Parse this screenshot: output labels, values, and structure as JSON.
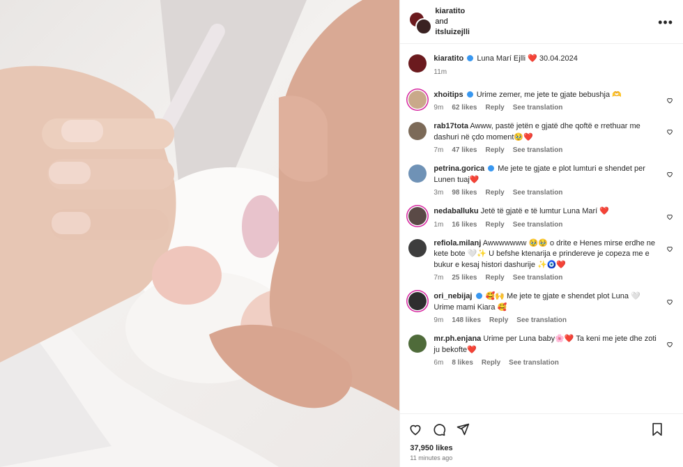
{
  "header": {
    "user1": "kiaratito",
    "joiner": "and",
    "user2": "itsluizejlli",
    "more_icon": "more-horizontal-icon"
  },
  "caption": {
    "user": "kiaratito",
    "text": "Luna Marí Ejlli ❤️ 30.04.2024",
    "time": "11m"
  },
  "comments": [
    {
      "user": "xhoitips",
      "verified": true,
      "text": "Urime zemer, me jete te gjate bebushja 🫶",
      "time": "9m",
      "likes": "62 likes",
      "reply": "Reply",
      "translate": "See translation",
      "avatar_color": "#c9a98a",
      "ring": true
    },
    {
      "user": "rab17tota",
      "verified": false,
      "text": "Awww, pastë jetën e gjatë dhe qoftë e rrethuar me dashuri në çdo moment🥹❤️",
      "time": "7m",
      "likes": "47 likes",
      "reply": "Reply",
      "translate": "See translation",
      "avatar_color": "#7c6a58",
      "ring": false
    },
    {
      "user": "petrina.gorica",
      "verified": true,
      "text": "Me jete te gjate e plot lumturi e shendet per Lunen tuaj❤️",
      "time": "3m",
      "likes": "98 likes",
      "reply": "Reply",
      "translate": "See translation",
      "avatar_color": "#6f92b6",
      "ring": false
    },
    {
      "user": "nedaballuku",
      "verified": false,
      "text": "Jetë të gjatë e të lumtur Luna Marí ❤️",
      "time": "1m",
      "likes": "16 likes",
      "reply": "Reply",
      "translate": "See translation",
      "avatar_color": "#5a4a46",
      "ring": true
    },
    {
      "user": "refiola.milanj",
      "verified": false,
      "text": "Awwwwwww 🥹🥹 o drite e Henes mirse erdhe ne kete bote 🤍✨ U befshe ktenarija e prindereve je copeza me e bukur e kesaj histori dashurije ✨🧿❤️",
      "time": "7m",
      "likes": "25 likes",
      "reply": "Reply",
      "translate": "See translation",
      "avatar_color": "#3d3d3d",
      "ring": false
    },
    {
      "user": "ori_nebijaj",
      "verified": true,
      "text": "🥰🙌 Me jete te gjate e shendet plot Luna 🤍 Urime mami Kiara 🥰",
      "time": "9m",
      "likes": "148 likes",
      "reply": "Reply",
      "translate": "See translation",
      "avatar_color": "#2e2e2e",
      "ring": true
    },
    {
      "user": "mr.ph.enjana",
      "verified": false,
      "text": "Urime per Luna baby🌸❤️ Ta keni me jete dhe zoti ju bekofte❤️",
      "time": "6m",
      "likes": "8 likes",
      "reply": "Reply",
      "translate": "See translation",
      "avatar_color": "#4f6b3a",
      "ring": false
    }
  ],
  "actions": {
    "like_icon": "heart-icon",
    "comment_icon": "comment-icon",
    "share_icon": "share-icon",
    "save_icon": "bookmark-icon"
  },
  "likes": "37,950 likes",
  "posted": "11 minutes ago"
}
